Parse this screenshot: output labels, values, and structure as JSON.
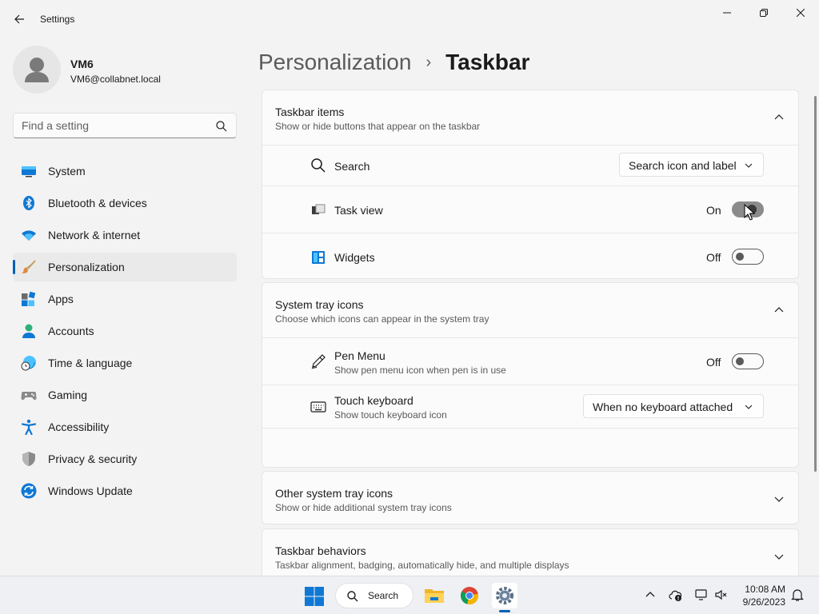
{
  "window": {
    "app_title": "Settings"
  },
  "profile": {
    "name": "VM6",
    "email": "VM6@collabnet.local"
  },
  "search": {
    "placeholder": "Find a setting"
  },
  "nav": {
    "items": [
      {
        "label": "System",
        "icon": "monitor-icon"
      },
      {
        "label": "Bluetooth & devices",
        "icon": "bluetooth-icon"
      },
      {
        "label": "Network & internet",
        "icon": "wifi-icon"
      },
      {
        "label": "Personalization",
        "icon": "paintbrush-icon",
        "active": true
      },
      {
        "label": "Apps",
        "icon": "apps-icon"
      },
      {
        "label": "Accounts",
        "icon": "person-icon"
      },
      {
        "label": "Time & language",
        "icon": "globe-clock-icon"
      },
      {
        "label": "Gaming",
        "icon": "gamepad-icon"
      },
      {
        "label": "Accessibility",
        "icon": "accessibility-icon"
      },
      {
        "label": "Privacy & security",
        "icon": "shield-icon"
      },
      {
        "label": "Windows Update",
        "icon": "update-icon"
      }
    ]
  },
  "header": {
    "parent": "Personalization",
    "separator": "›",
    "current": "Taskbar"
  },
  "taskbar_items": {
    "title": "Taskbar items",
    "description": "Show or hide buttons that appear on the taskbar",
    "search": {
      "label": "Search",
      "value": "Search icon and label"
    },
    "task_view": {
      "label": "Task view",
      "state": "On"
    },
    "widgets": {
      "label": "Widgets",
      "state": "Off"
    }
  },
  "system_tray": {
    "title": "System tray icons",
    "description": "Choose which icons can appear in the system tray",
    "pen_menu": {
      "label": "Pen Menu",
      "sub": "Show pen menu icon when pen is in use",
      "state": "Off"
    },
    "touch_keyboard": {
      "label": "Touch keyboard",
      "sub": "Show touch keyboard icon",
      "value": "When no keyboard attached"
    }
  },
  "other_tray": {
    "title": "Other system tray icons",
    "description": "Show or hide additional system tray icons"
  },
  "behaviors": {
    "title": "Taskbar behaviors",
    "description": "Taskbar alignment, badging, automatically hide, and multiple displays"
  },
  "taskbar": {
    "search_label": "Search",
    "time": "10:08 AM",
    "date": "9/26/2023"
  },
  "colors": {
    "accent": "#005fb8",
    "background": "#f3f3f3",
    "card": "#fbfbfb"
  }
}
